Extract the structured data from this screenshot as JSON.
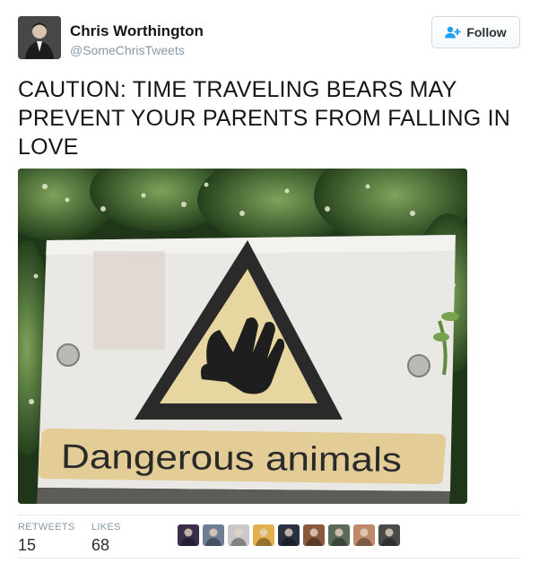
{
  "author": {
    "name": "Chris Worthington",
    "handle": "@SomeChrisTweets"
  },
  "follow_button": {
    "label": "Follow",
    "icon": "add-user-icon",
    "accent": "#1da1f2"
  },
  "tweet": {
    "text": "CAUTION: TIME TRAVELING BEARS MAY PREVENT YOUR PARENTS FROM FALLING IN LOVE"
  },
  "media": {
    "sign_text": "Dangerous animals"
  },
  "stats": {
    "retweets_label": "RETWEETS",
    "retweets_count": "15",
    "likes_label": "LIKES",
    "likes_count": "68"
  },
  "liker_avatars": [
    {
      "color": "#3a2f4a"
    },
    {
      "color": "#6e7f95"
    },
    {
      "color": "#c9c9c9"
    },
    {
      "color": "#e3b04b"
    },
    {
      "color": "#2a3140"
    },
    {
      "color": "#8a5a3c"
    },
    {
      "color": "#5b6b5a"
    },
    {
      "color": "#c08a6a"
    },
    {
      "color": "#4a4a4a"
    }
  ]
}
